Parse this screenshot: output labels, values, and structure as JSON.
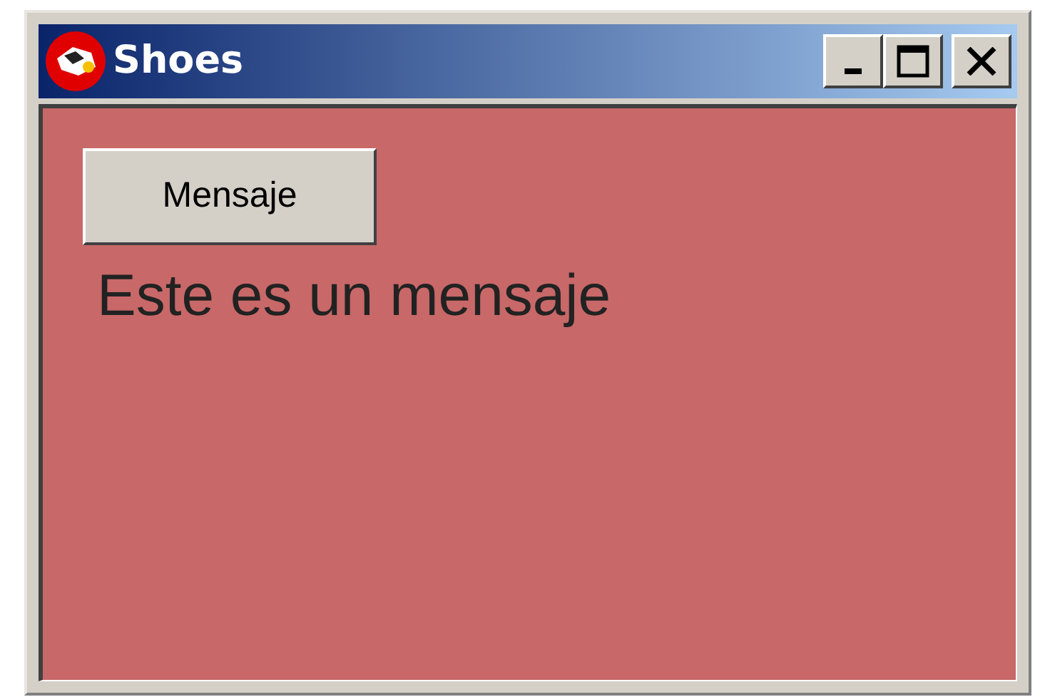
{
  "window": {
    "title": "Shoes"
  },
  "content": {
    "button": "Mensaje",
    "message": "Este es un mensaje"
  }
}
